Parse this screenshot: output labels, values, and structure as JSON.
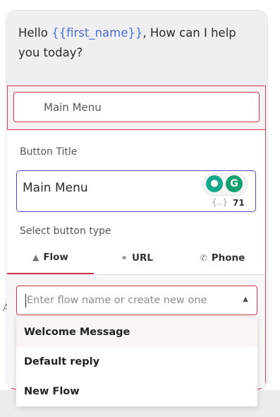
{
  "message": {
    "prefix": "Hello ",
    "variable": "{{first_name}}",
    "suffix": ", How can I help you today?"
  },
  "button": {
    "label": "Main Menu"
  },
  "editor": {
    "title_label": "Button Title",
    "title_value": "Main Menu",
    "variable_icon": "{..}",
    "char_count": "71",
    "type_label": "Select button type"
  },
  "tabs": [
    {
      "label": "Flow",
      "icon": "flow-icon"
    },
    {
      "label": "URL",
      "icon": "link-icon"
    },
    {
      "label": "Phone",
      "icon": "phone-icon"
    }
  ],
  "flow_select": {
    "placeholder": "Enter flow name or create new one",
    "options": [
      "Welcome Message",
      "Default reply",
      "New Flow"
    ]
  },
  "colors": {
    "accent_red": "#cf3a4a",
    "focus_purple": "#4e44d4",
    "variable_blue": "#4b6fd6"
  }
}
